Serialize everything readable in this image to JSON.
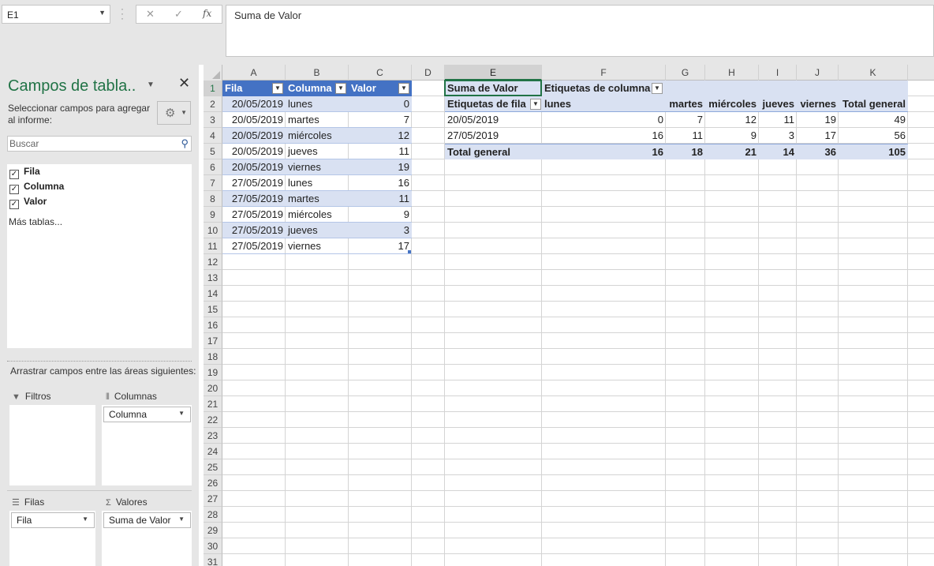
{
  "name_box": "E1",
  "formula_bar": {
    "content": "Suma de Valor",
    "cancel": "✕",
    "enter": "✓",
    "fx": "fx"
  },
  "pane": {
    "title": "Campos de tabla..",
    "subtitle": "Seleccionar campos para agregar al informe:",
    "search_placeholder": "Buscar",
    "fields": [
      {
        "label": "Fila",
        "checked": true
      },
      {
        "label": "Columna",
        "checked": true
      },
      {
        "label": "Valor",
        "checked": true
      }
    ],
    "more_tables": "Más tablas...",
    "drag_label": "Arrastrar campos entre las áreas siguientes:",
    "areas": {
      "filters": {
        "label": "Filtros"
      },
      "columns": {
        "label": "Columnas",
        "item": "Columna"
      },
      "rows": {
        "label": "Filas",
        "item": "Fila"
      },
      "values": {
        "label": "Valores",
        "item": "Suma de Valor"
      }
    }
  },
  "sheet": {
    "columns": [
      "A",
      "B",
      "C",
      "D",
      "E",
      "F",
      "G",
      "H",
      "I",
      "J",
      "K"
    ],
    "row_numbers": [
      "1",
      "2",
      "3",
      "4",
      "5",
      "6",
      "7",
      "8",
      "9",
      "10",
      "11",
      "12",
      "13",
      "14",
      "15",
      "16",
      "17",
      "18",
      "19",
      "20",
      "21",
      "22",
      "23",
      "24",
      "25",
      "26",
      "27",
      "28",
      "29",
      "30",
      "31"
    ],
    "table_headers": [
      "Fila",
      "Columna",
      "Valor"
    ],
    "table_rows": [
      [
        "20/05/2019",
        "lunes",
        "0"
      ],
      [
        "20/05/2019",
        "martes",
        "7"
      ],
      [
        "20/05/2019",
        "miércoles",
        "12"
      ],
      [
        "20/05/2019",
        "jueves",
        "11"
      ],
      [
        "20/05/2019",
        "viernes",
        "19"
      ],
      [
        "27/05/2019",
        "lunes",
        "16"
      ],
      [
        "27/05/2019",
        "martes",
        "11"
      ],
      [
        "27/05/2019",
        "miércoles",
        "9"
      ],
      [
        "27/05/2019",
        "jueves",
        "3"
      ],
      [
        "27/05/2019",
        "viernes",
        "17"
      ]
    ],
    "pivot": {
      "value_label": "Suma de Valor",
      "col_labels_title": "Etiquetas de columna",
      "row_labels_title": "Etiquetas de fila",
      "col_headers": [
        "lunes",
        "martes",
        "miércoles",
        "jueves",
        "viernes",
        "Total general"
      ],
      "rows": [
        {
          "label": "20/05/2019",
          "values": [
            "0",
            "7",
            "12",
            "11",
            "19",
            "49"
          ]
        },
        {
          "label": "27/05/2019",
          "values": [
            "16",
            "11",
            "9",
            "3",
            "17",
            "56"
          ]
        }
      ],
      "total": {
        "label": "Total general",
        "values": [
          "16",
          "18",
          "21",
          "14",
          "36",
          "105"
        ]
      }
    }
  },
  "colors": {
    "accent": "#217346",
    "table_header": "#4472c4",
    "band": "#d9e1f2"
  }
}
